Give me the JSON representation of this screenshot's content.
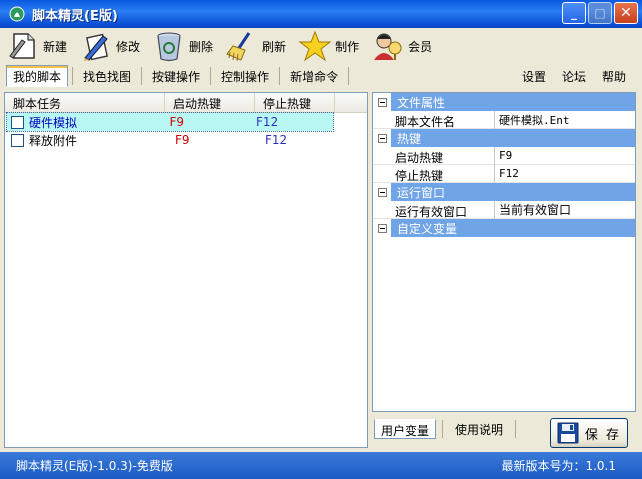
{
  "window": {
    "title": "脚本精灵(E版)",
    "minimize": "_",
    "maximize": "□",
    "close": "✕"
  },
  "toolbar": [
    {
      "label": "新建",
      "icon": "new-document-icon"
    },
    {
      "label": "修改",
      "icon": "edit-pen-icon"
    },
    {
      "label": "删除",
      "icon": "recycle-bin-icon"
    },
    {
      "label": "刷新",
      "icon": "broom-icon"
    },
    {
      "label": "制作",
      "icon": "star-icon"
    },
    {
      "label": "会员",
      "icon": "members-icon"
    }
  ],
  "nav": {
    "tabs": [
      "我的脚本",
      "找色找图",
      "按键操作",
      "控制操作",
      "新增命令"
    ],
    "active_tab": "我的脚本",
    "right": [
      "设置",
      "论坛",
      "帮助"
    ]
  },
  "script_list": {
    "columns": [
      "脚本任务",
      "启动热键",
      "停止热键"
    ],
    "rows": [
      {
        "name": "硬件模拟",
        "start": "F9",
        "stop": "F12",
        "selected": true
      },
      {
        "name": "释放附件",
        "start": "F9",
        "stop": "F12",
        "selected": false
      }
    ]
  },
  "properties": {
    "groups": [
      {
        "name": "文件属性",
        "rows": [
          {
            "key": "脚本文件名",
            "value": "硬件模拟.Ent"
          }
        ]
      },
      {
        "name": "热键",
        "rows": [
          {
            "key": "启动热键",
            "value": "F9"
          },
          {
            "key": "停止热键",
            "value": "F12"
          }
        ]
      },
      {
        "name": "运行窗口",
        "rows": [
          {
            "key": "运行有效窗口",
            "value": "当前有效窗口"
          }
        ]
      },
      {
        "name": "自定义变量",
        "rows": []
      }
    ]
  },
  "bottom_tabs": [
    "用户变量",
    "使用说明"
  ],
  "save_label": "保 存",
  "status": {
    "left": "脚本精灵(E版)-1.0.3)-免费版",
    "right": "最新版本号为：1.0.1"
  },
  "colors": {
    "title_bar": "#1d68e8",
    "status_bar": "#2a6ad0",
    "selected_row": "#b8f8f4",
    "group_header": "#6fa4e6",
    "hotkey_start": "#d00000",
    "hotkey_stop": "#3030c0"
  }
}
